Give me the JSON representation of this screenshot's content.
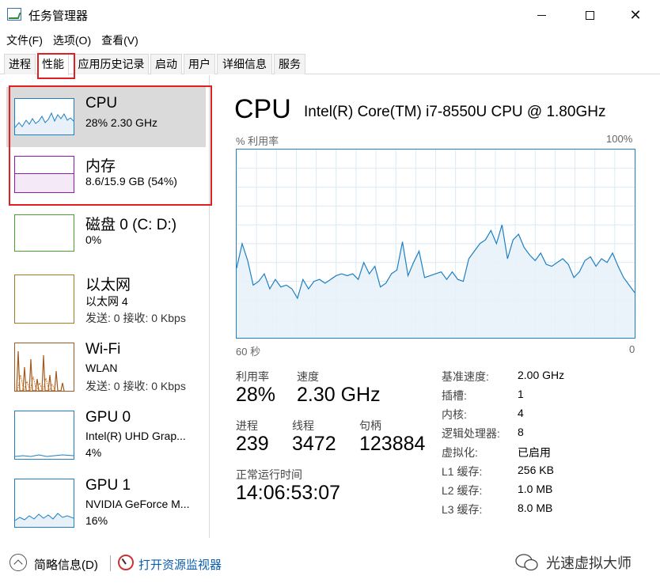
{
  "window": {
    "title": "任务管理器",
    "minimize_icon": "minimize-icon",
    "maximize_icon": "maximize-icon",
    "close_icon": "close-icon"
  },
  "menu": [
    "文件(F)",
    "选项(O)",
    "查看(V)"
  ],
  "tabs": [
    "进程",
    "性能",
    "应用历史记录",
    "启动",
    "用户",
    "详细信息",
    "服务"
  ],
  "active_tab": "性能",
  "sidebar": {
    "cpu": {
      "title": "CPU",
      "sub": "28%  2.30 GHz"
    },
    "memory": {
      "title": "内存",
      "sub": "8.6/15.9 GB (54%)"
    },
    "disk": {
      "title": "磁盘 0 (C: D:)",
      "sub": "0%"
    },
    "ethernet": {
      "title": "以太网",
      "sub1": "以太网 4",
      "sub2": "发送: 0 接收: 0 Kbps"
    },
    "wifi": {
      "title": "Wi-Fi",
      "sub1": "WLAN",
      "sub2": "发送: 0 接收: 0 Kbps"
    },
    "gpu0": {
      "title": "GPU 0",
      "sub1": "Intel(R) UHD Grap...",
      "sub2": "4%"
    },
    "gpu1": {
      "title": "GPU 1",
      "sub1": "NVIDIA GeForce M...",
      "sub2": "16%"
    }
  },
  "main": {
    "title": "CPU",
    "model": "Intel(R) Core(TM) i7-8550U CPU @ 1.80GHz",
    "graph_label_left": "% 利用率",
    "graph_label_right": "100%",
    "time_left": "60 秒",
    "time_right": "0"
  },
  "stats": {
    "utilization": {
      "label": "利用率",
      "value": "28%"
    },
    "speed": {
      "label": "速度",
      "value": "2.30 GHz"
    },
    "processes": {
      "label": "进程",
      "value": "239"
    },
    "threads": {
      "label": "线程",
      "value": "3472"
    },
    "handles": {
      "label": "句柄",
      "value": "123884"
    },
    "uptime": {
      "label": "正常运行时间",
      "value": "14:06:53:07"
    }
  },
  "specs": [
    {
      "label": "基准速度:",
      "value": "2.00 GHz"
    },
    {
      "label": "插槽:",
      "value": "1"
    },
    {
      "label": "内核:",
      "value": "4"
    },
    {
      "label": "逻辑处理器:",
      "value": "8"
    },
    {
      "label": "虚拟化:",
      "value": "已启用"
    },
    {
      "label": "L1 缓存:",
      "value": "256 KB"
    },
    {
      "label": "L2 缓存:",
      "value": "1.0 MB"
    },
    {
      "label": "L3 缓存:",
      "value": "8.0 MB"
    }
  ],
  "footer": {
    "brief": "简略信息(D)",
    "monitor_link": "打开资源监视器",
    "watermark": "光速虚拟大师"
  },
  "chart_data": {
    "type": "area",
    "ylim": [
      0,
      100
    ],
    "xlabel_left": "60 秒",
    "xlabel_right": "0",
    "ylabel": "% 利用率",
    "values": [
      37,
      50,
      41,
      28,
      30,
      34,
      26,
      31,
      27,
      28,
      26,
      21,
      31,
      26,
      30,
      31,
      29,
      31,
      33,
      34,
      33,
      34,
      31,
      40,
      34,
      38,
      27,
      29,
      34,
      36,
      51,
      33,
      40,
      46,
      32,
      33,
      34,
      35,
      31,
      35,
      31,
      30,
      42,
      46,
      50,
      52,
      57,
      50,
      60,
      42,
      52,
      55,
      48,
      44,
      41,
      45,
      39,
      38,
      40,
      42,
      39,
      32,
      35,
      41,
      43,
      38,
      42,
      40,
      45,
      38,
      32,
      28,
      24
    ]
  },
  "colors": {
    "cpu_line": "#1e7fc3",
    "cpu_fill": "#e8f1f9",
    "memory_line": "#8b1aa8",
    "memory_fill": "#f4e9f7",
    "disk_line": "#4aa02c",
    "ethernet_line": "#a77b1b",
    "wifi_line": "#a05a1f",
    "highlight_box": "#e02020"
  }
}
